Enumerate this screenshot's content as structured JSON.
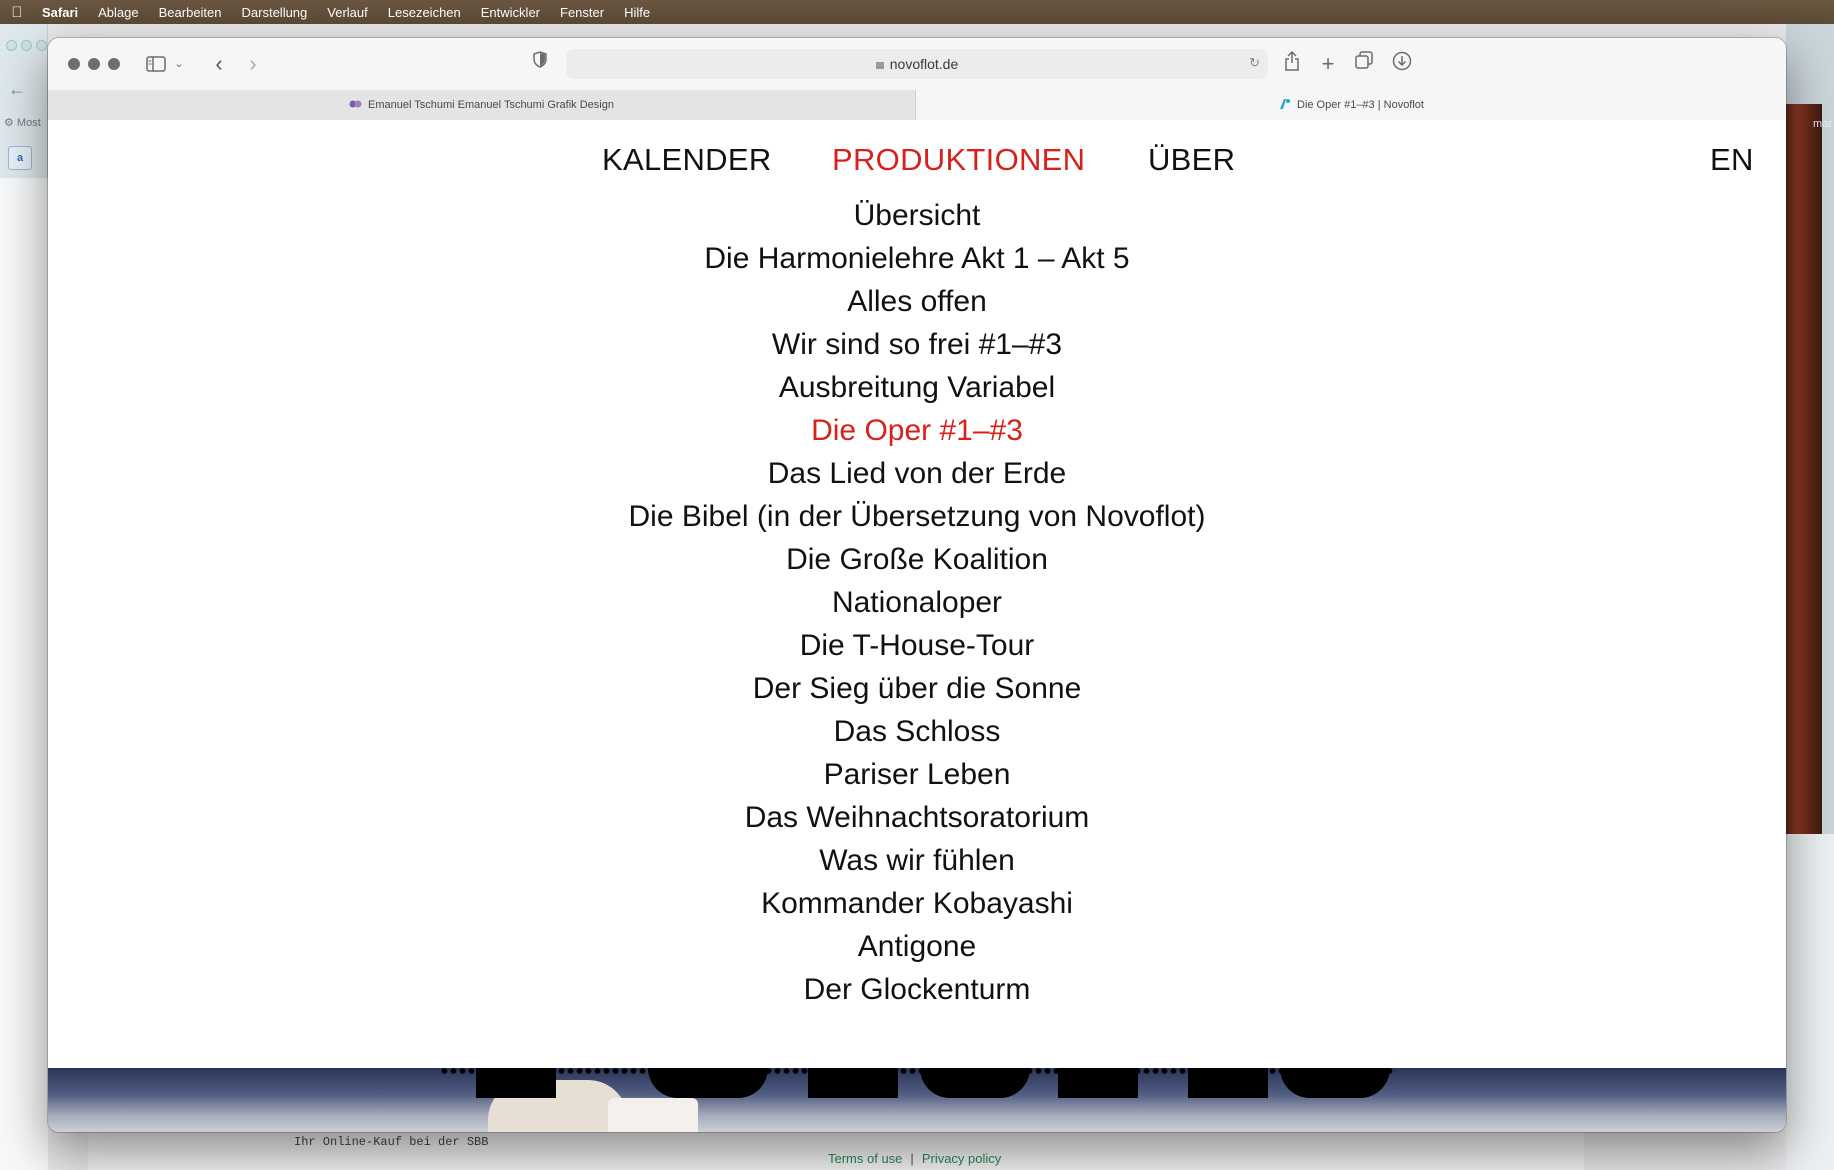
{
  "menubar": {
    "items": [
      "Safari",
      "Ablage",
      "Bearbeiten",
      "Darstellung",
      "Verlauf",
      "Lesezeichen",
      "Entwickler",
      "Fenster",
      "Hilfe"
    ]
  },
  "background_window": {
    "left_snippet": "Most",
    "right_snippet": "mar",
    "footer_text": "Ihr Online-Kauf bei der SBB",
    "footer_links": [
      "Terms of use",
      "Privacy policy"
    ],
    "footer_separator": "|"
  },
  "browser": {
    "url": "novoflot.de",
    "tabs": [
      {
        "title": "Emanuel Tschumi Emanuel Tschumi Grafik Design",
        "icon": "purple-emblem-icon",
        "active": false
      },
      {
        "title": "Die Oper #1–#3 | Novoflot",
        "icon": "novoflot-logo-icon",
        "active": true
      }
    ]
  },
  "page": {
    "nav": [
      {
        "label": "KALENDER",
        "active": false
      },
      {
        "label": "PRODUKTIONEN",
        "active": true
      },
      {
        "label": "ÜBER",
        "active": false
      }
    ],
    "language": "EN",
    "productions": [
      {
        "label": "Übersicht",
        "active": false
      },
      {
        "label": "Die Harmonielehre Akt 1 – Akt 5",
        "active": false
      },
      {
        "label": "Alles offen",
        "active": false
      },
      {
        "label": "Wir sind so frei #1–#3",
        "active": false
      },
      {
        "label": "Ausbreitung Variabel",
        "active": false
      },
      {
        "label": "Die Oper #1–#3",
        "active": true
      },
      {
        "label": "Das Lied von der Erde",
        "active": false
      },
      {
        "label": "Die Bibel (in der Übersetzung von Novoflot)",
        "active": false
      },
      {
        "label": "Die Große Koalition",
        "active": false
      },
      {
        "label": "Nationaloper",
        "active": false
      },
      {
        "label": "Die T-House-Tour",
        "active": false
      },
      {
        "label": "Der Sieg über die Sonne",
        "active": false
      },
      {
        "label": "Das Schloss",
        "active": false
      },
      {
        "label": "Pariser Leben",
        "active": false
      },
      {
        "label": "Das Weihnachtsoratorium",
        "active": false
      },
      {
        "label": "Was wir fühlen",
        "active": false
      },
      {
        "label": "Kommander Kobayashi",
        "active": false
      },
      {
        "label": "Antigone",
        "active": false
      },
      {
        "label": "Der Glockenturm",
        "active": false
      }
    ]
  },
  "colors": {
    "accent_red": "#d6211c",
    "text": "#111111",
    "menubar": "#5f4c38"
  }
}
